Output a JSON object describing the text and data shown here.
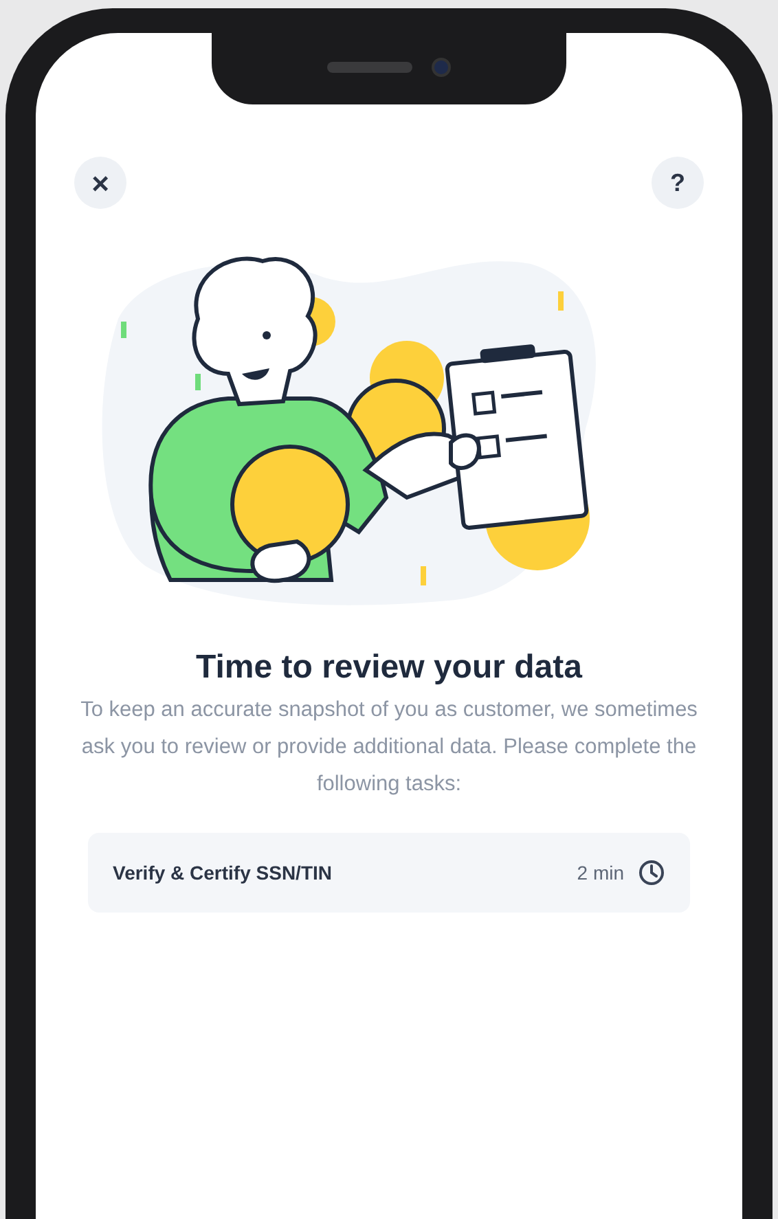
{
  "top_bar": {
    "close_button": "×",
    "help_button": "?"
  },
  "title": "Time to review your data",
  "description": "To keep an accurate snapshot of you as customer, we sometimes ask you to review or provide additional data. Please complete the following tasks:",
  "tasks": [
    {
      "label": "Verify & Certify SSN/TIN",
      "duration": "2 min"
    }
  ]
}
